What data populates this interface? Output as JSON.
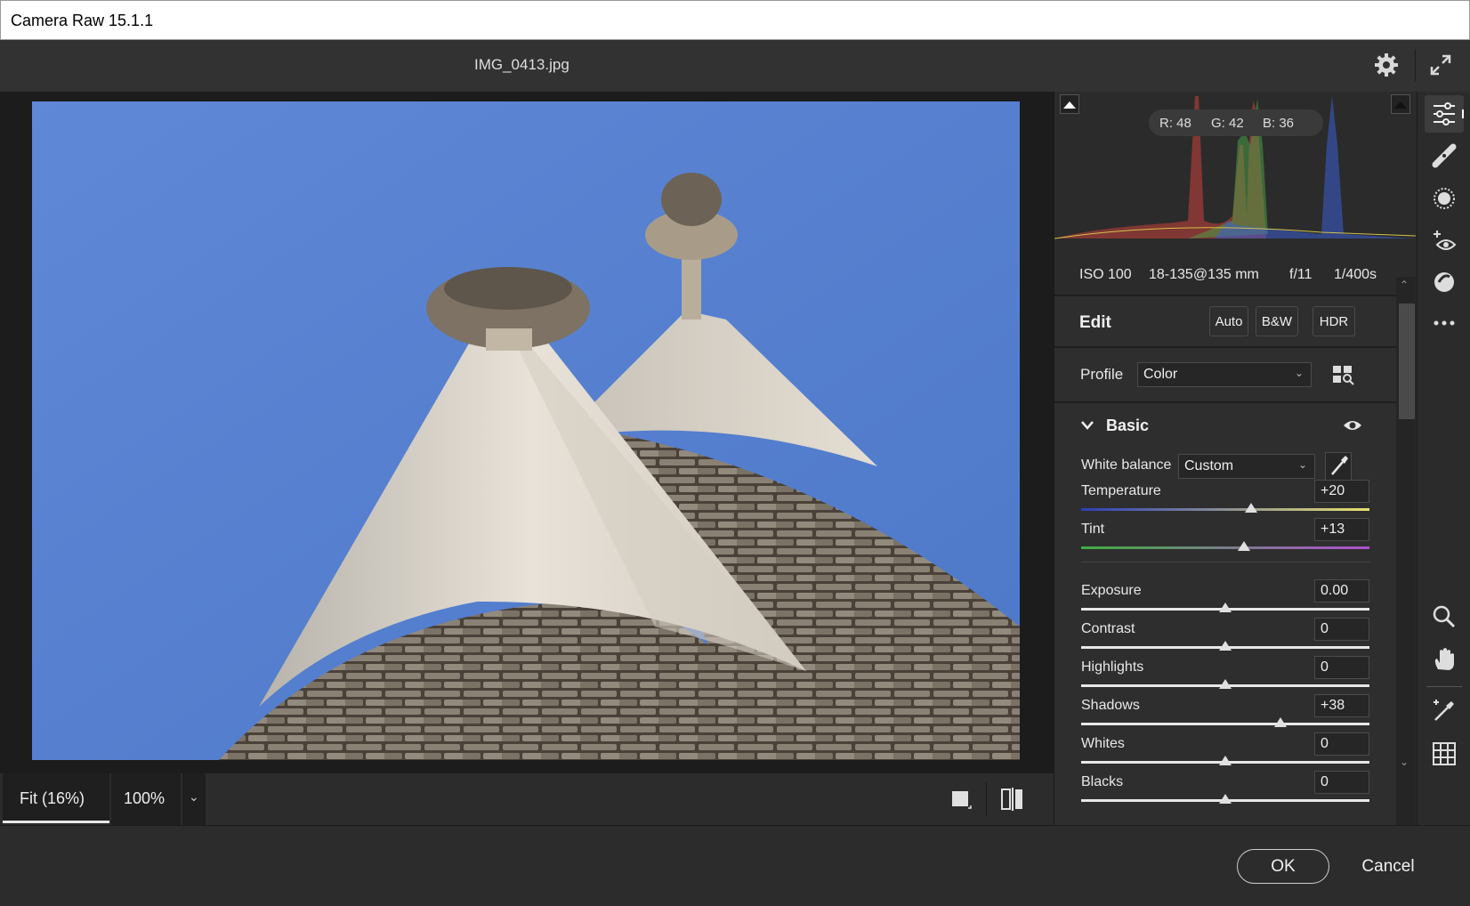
{
  "window": {
    "title": "Camera Raw 15.1.1"
  },
  "file": {
    "name": "IMG_0413.jpg"
  },
  "histogram": {
    "r_label": "R: 48",
    "g_label": "G: 42",
    "b_label": "B: 36"
  },
  "camera_info": {
    "iso": "ISO 100",
    "lens": "18-135@135 mm",
    "aperture": "f/11",
    "shutter": "1/400s"
  },
  "edit": {
    "label": "Edit",
    "auto_label": "Auto",
    "bw_label": "B&W",
    "hdr_label": "HDR"
  },
  "profile": {
    "label": "Profile",
    "value": "Color"
  },
  "basic": {
    "label": "Basic",
    "white_balance_label": "White balance",
    "white_balance_value": "Custom",
    "sliders": [
      {
        "name": "Temperature",
        "value": "+20",
        "level": 0.59
      },
      {
        "name": "Tint",
        "value": "+13",
        "level": 0.565
      },
      {
        "name": "Exposure",
        "value": "0.00",
        "level": 0.5
      },
      {
        "name": "Contrast",
        "value": "0",
        "level": 0.5
      },
      {
        "name": "Highlights",
        "value": "0",
        "level": 0.5
      },
      {
        "name": "Shadows",
        "value": "+38",
        "level": 0.69
      },
      {
        "name": "Whites",
        "value": "0",
        "level": 0.5
      },
      {
        "name": "Blacks",
        "value": "0",
        "level": 0.5
      }
    ]
  },
  "view": {
    "fit_label": "Fit (16%)",
    "zoom_label": "100%"
  },
  "footer": {
    "ok_label": "OK",
    "cancel_label": "Cancel"
  },
  "icons": [
    "gear-icon",
    "expand-icon",
    "edit-sliders-icon",
    "healing-icon",
    "mask-icon",
    "redeye-icon",
    "presets-icon",
    "more-icon",
    "zoom-icon",
    "hand-icon",
    "color-sampler-icon",
    "grid-icon",
    "single-view-icon",
    "before-after-icon",
    "eyedropper-icon",
    "eye-icon",
    "chevron-down-icon",
    "profile-browser-icon"
  ],
  "colors": {
    "accent": "#e8e8e8",
    "sky": "#5f87d3"
  }
}
